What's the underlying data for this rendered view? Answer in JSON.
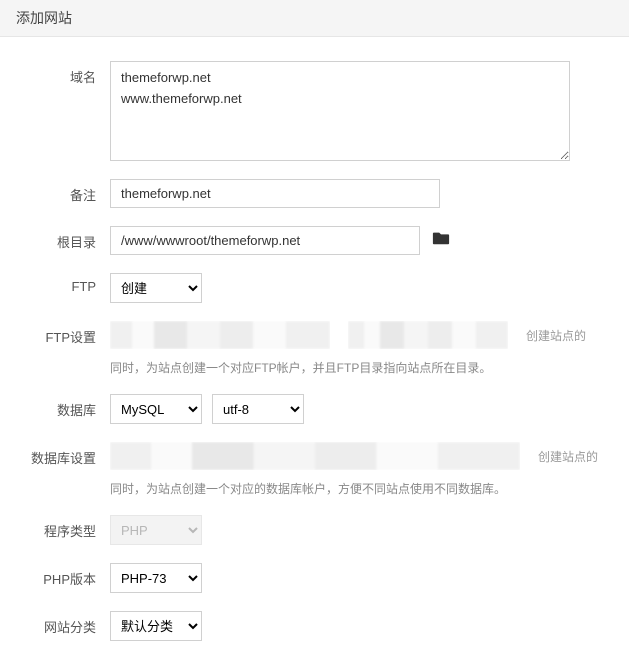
{
  "header": {
    "title": "添加网站"
  },
  "labels": {
    "domain": "域名",
    "remark": "备注",
    "root": "根目录",
    "ftp": "FTP",
    "ftp_settings": "FTP设置",
    "database": "数据库",
    "database_settings": "数据库设置",
    "program_type": "程序类型",
    "php_version": "PHP版本",
    "site_category": "网站分类"
  },
  "values": {
    "domain": "themeforwp.net\nwww.themeforwp.net",
    "remark": "themeforwp.net",
    "root": "/www/wwwroot/themeforwp.net",
    "ftp": "创建",
    "database_engine": "MySQL",
    "database_charset": "utf-8",
    "program_type": "PHP",
    "php_version": "PHP-73",
    "site_category": "默认分类"
  },
  "hints": {
    "ftp": "同时，为站点创建一个对应FTP帐户，并且FTP目录指向站点所在目录。",
    "database": "同时，为站点创建一个对应的数据库帐户，方便不同站点使用不同数据库。",
    "side": "创建站点的"
  }
}
